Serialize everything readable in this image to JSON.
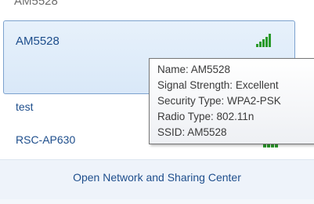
{
  "networks": {
    "top_partial": "AM5528",
    "selected": "AM5528",
    "items": [
      "test",
      "RSC-AP630"
    ]
  },
  "tooltip": {
    "name": "Name: AM5528",
    "signal": "Signal Strength: Excellent",
    "security": "Security Type: WPA2-PSK",
    "radio": "Radio Type: 802.11n",
    "ssid": "SSID: AM5528"
  },
  "footer": {
    "link": "Open Network and Sharing Center"
  },
  "colors": {
    "link_blue": "#1e4e8c",
    "signal_green": "#2a9a2a",
    "selection_border": "#7da2ce"
  },
  "icons": {
    "signal": "signal-strength-icon"
  }
}
